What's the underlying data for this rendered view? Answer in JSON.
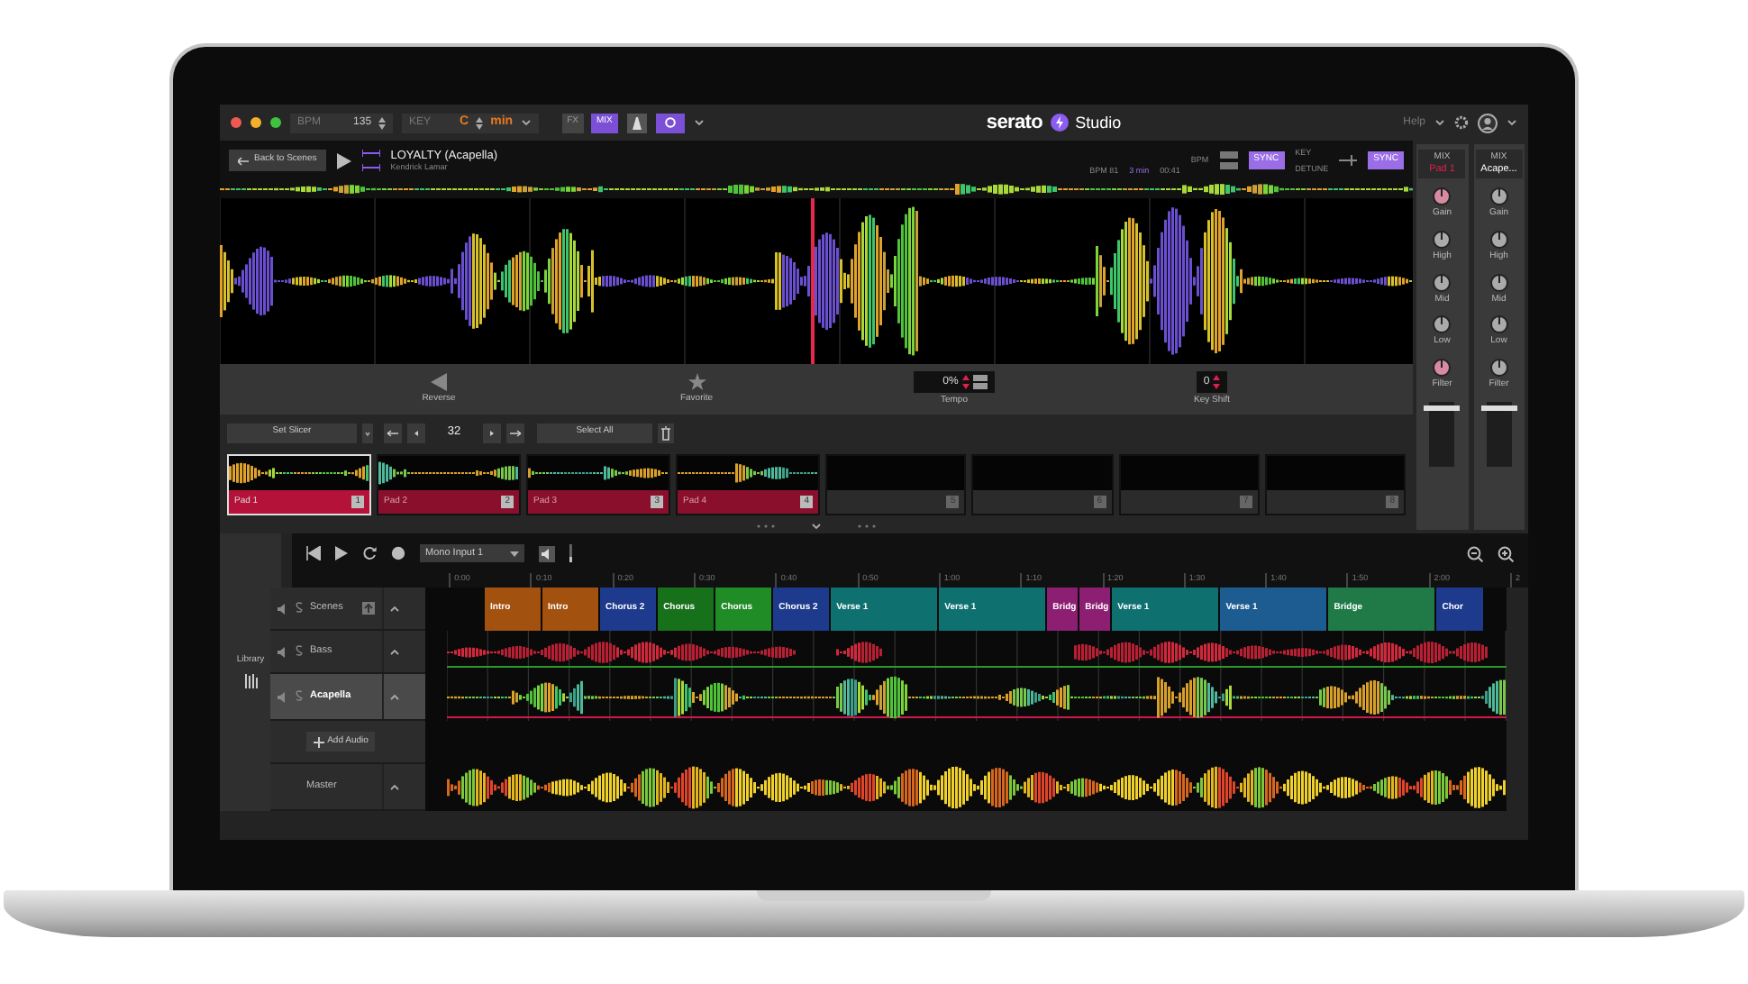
{
  "top_bar": {
    "bpm_label": "BPM",
    "bpm": "135",
    "key_label": "KEY",
    "key": "C",
    "scale": "min",
    "mode_buttons": [
      {
        "label": "FX",
        "selected": false
      },
      {
        "label": "MIX",
        "selected": true
      }
    ],
    "logo": "serato",
    "logo_product": "Studio",
    "help": "Help"
  },
  "deck": {
    "back": "Back to Scenes",
    "title": "LOYALTY (Acapella)",
    "artist": "Kendrick Lamar",
    "info": [
      "BPM 81",
      "3 min",
      "00:41"
    ],
    "bpm_label": "BPM",
    "key_label": "KEY",
    "detune_label": "DETUNE",
    "sync_buttons": [
      "SYNC",
      "SYNC"
    ]
  },
  "controls": [
    {
      "kind": "reverse",
      "label": "Reverse"
    },
    {
      "kind": "favorite",
      "label": "Favorite"
    },
    {
      "kind": "value",
      "value": "0%",
      "label": "Tempo"
    },
    {
      "kind": "value",
      "value": "0",
      "label": "Key Shift"
    }
  ],
  "slicer": {
    "mode": "Set Slicer",
    "count": "32",
    "select_all": "Select All"
  },
  "pads": [
    {
      "kind": "sample",
      "label": "Pad 1",
      "number": "1",
      "selected": true
    },
    {
      "kind": "sample",
      "label": "Pad 2",
      "number": "2",
      "selected": false
    },
    {
      "kind": "sample",
      "label": "Pad 3",
      "number": "3",
      "selected": false
    },
    {
      "kind": "sample",
      "label": "Pad 4",
      "number": "4",
      "selected": false
    },
    {
      "kind": "empty",
      "number": "5",
      "selected": false
    },
    {
      "kind": "empty",
      "number": "6",
      "selected": false
    },
    {
      "kind": "empty",
      "number": "7",
      "selected": false
    },
    {
      "kind": "empty",
      "number": "8",
      "selected": false
    }
  ],
  "mixer": [
    {
      "label": "MIX",
      "name": "Pad 1",
      "color": "#e0204a",
      "knobs": [
        "Gain",
        "High",
        "Mid",
        "Low",
        "Filter"
      ]
    },
    {
      "label": "MIX",
      "name": "Acape...",
      "color": "#ffffff",
      "knobs": [
        "Gain",
        "High",
        "Mid",
        "Low",
        "Filter"
      ]
    }
  ],
  "library": "Library",
  "transport": {
    "input": "Mono Input 1"
  },
  "timeline": {
    "ticks": [
      "0:00",
      "0:10",
      "0:20",
      "0:30",
      "0:40",
      "0:50",
      "1:00",
      "1:10",
      "1:20",
      "1:30",
      "1:40",
      "1:50",
      "2:00",
      "2"
    ],
    "scenes": [
      {
        "label": "Intro",
        "color": "#a3510f"
      },
      {
        "label": "Intro",
        "color": "#a3510f"
      },
      {
        "label": "Chorus 2",
        "color": "#1d3a8c"
      },
      {
        "label": "Chorus",
        "color": "#17701a"
      },
      {
        "label": "Chorus",
        "color": "#1f8c25"
      },
      {
        "label": "Chorus 2",
        "color": "#1d3a8c"
      },
      {
        "label": "Verse 1",
        "color": "#0f7070"
      },
      {
        "label": "Verse 1",
        "color": "#0f7070"
      },
      {
        "label": "Bridg",
        "color": "#8c1f72"
      },
      {
        "label": "Bridg",
        "color": "#8c1f72"
      },
      {
        "label": "Verse 1",
        "color": "#0f7070"
      },
      {
        "label": "Verse 1",
        "color": "#1d5c90"
      },
      {
        "label": "Bridge",
        "color": "#1f7a48"
      },
      {
        "label": "Chor",
        "color": "#1d3a8c"
      }
    ],
    "tracks": [
      {
        "kind": "scenes",
        "name": "Scenes",
        "selected": false
      },
      {
        "kind": "audio",
        "name": "Bass",
        "selected": false
      },
      {
        "kind": "audio",
        "name": "Acapella",
        "selected": true
      }
    ],
    "add_audio": "Add Audio",
    "master": "Master"
  }
}
